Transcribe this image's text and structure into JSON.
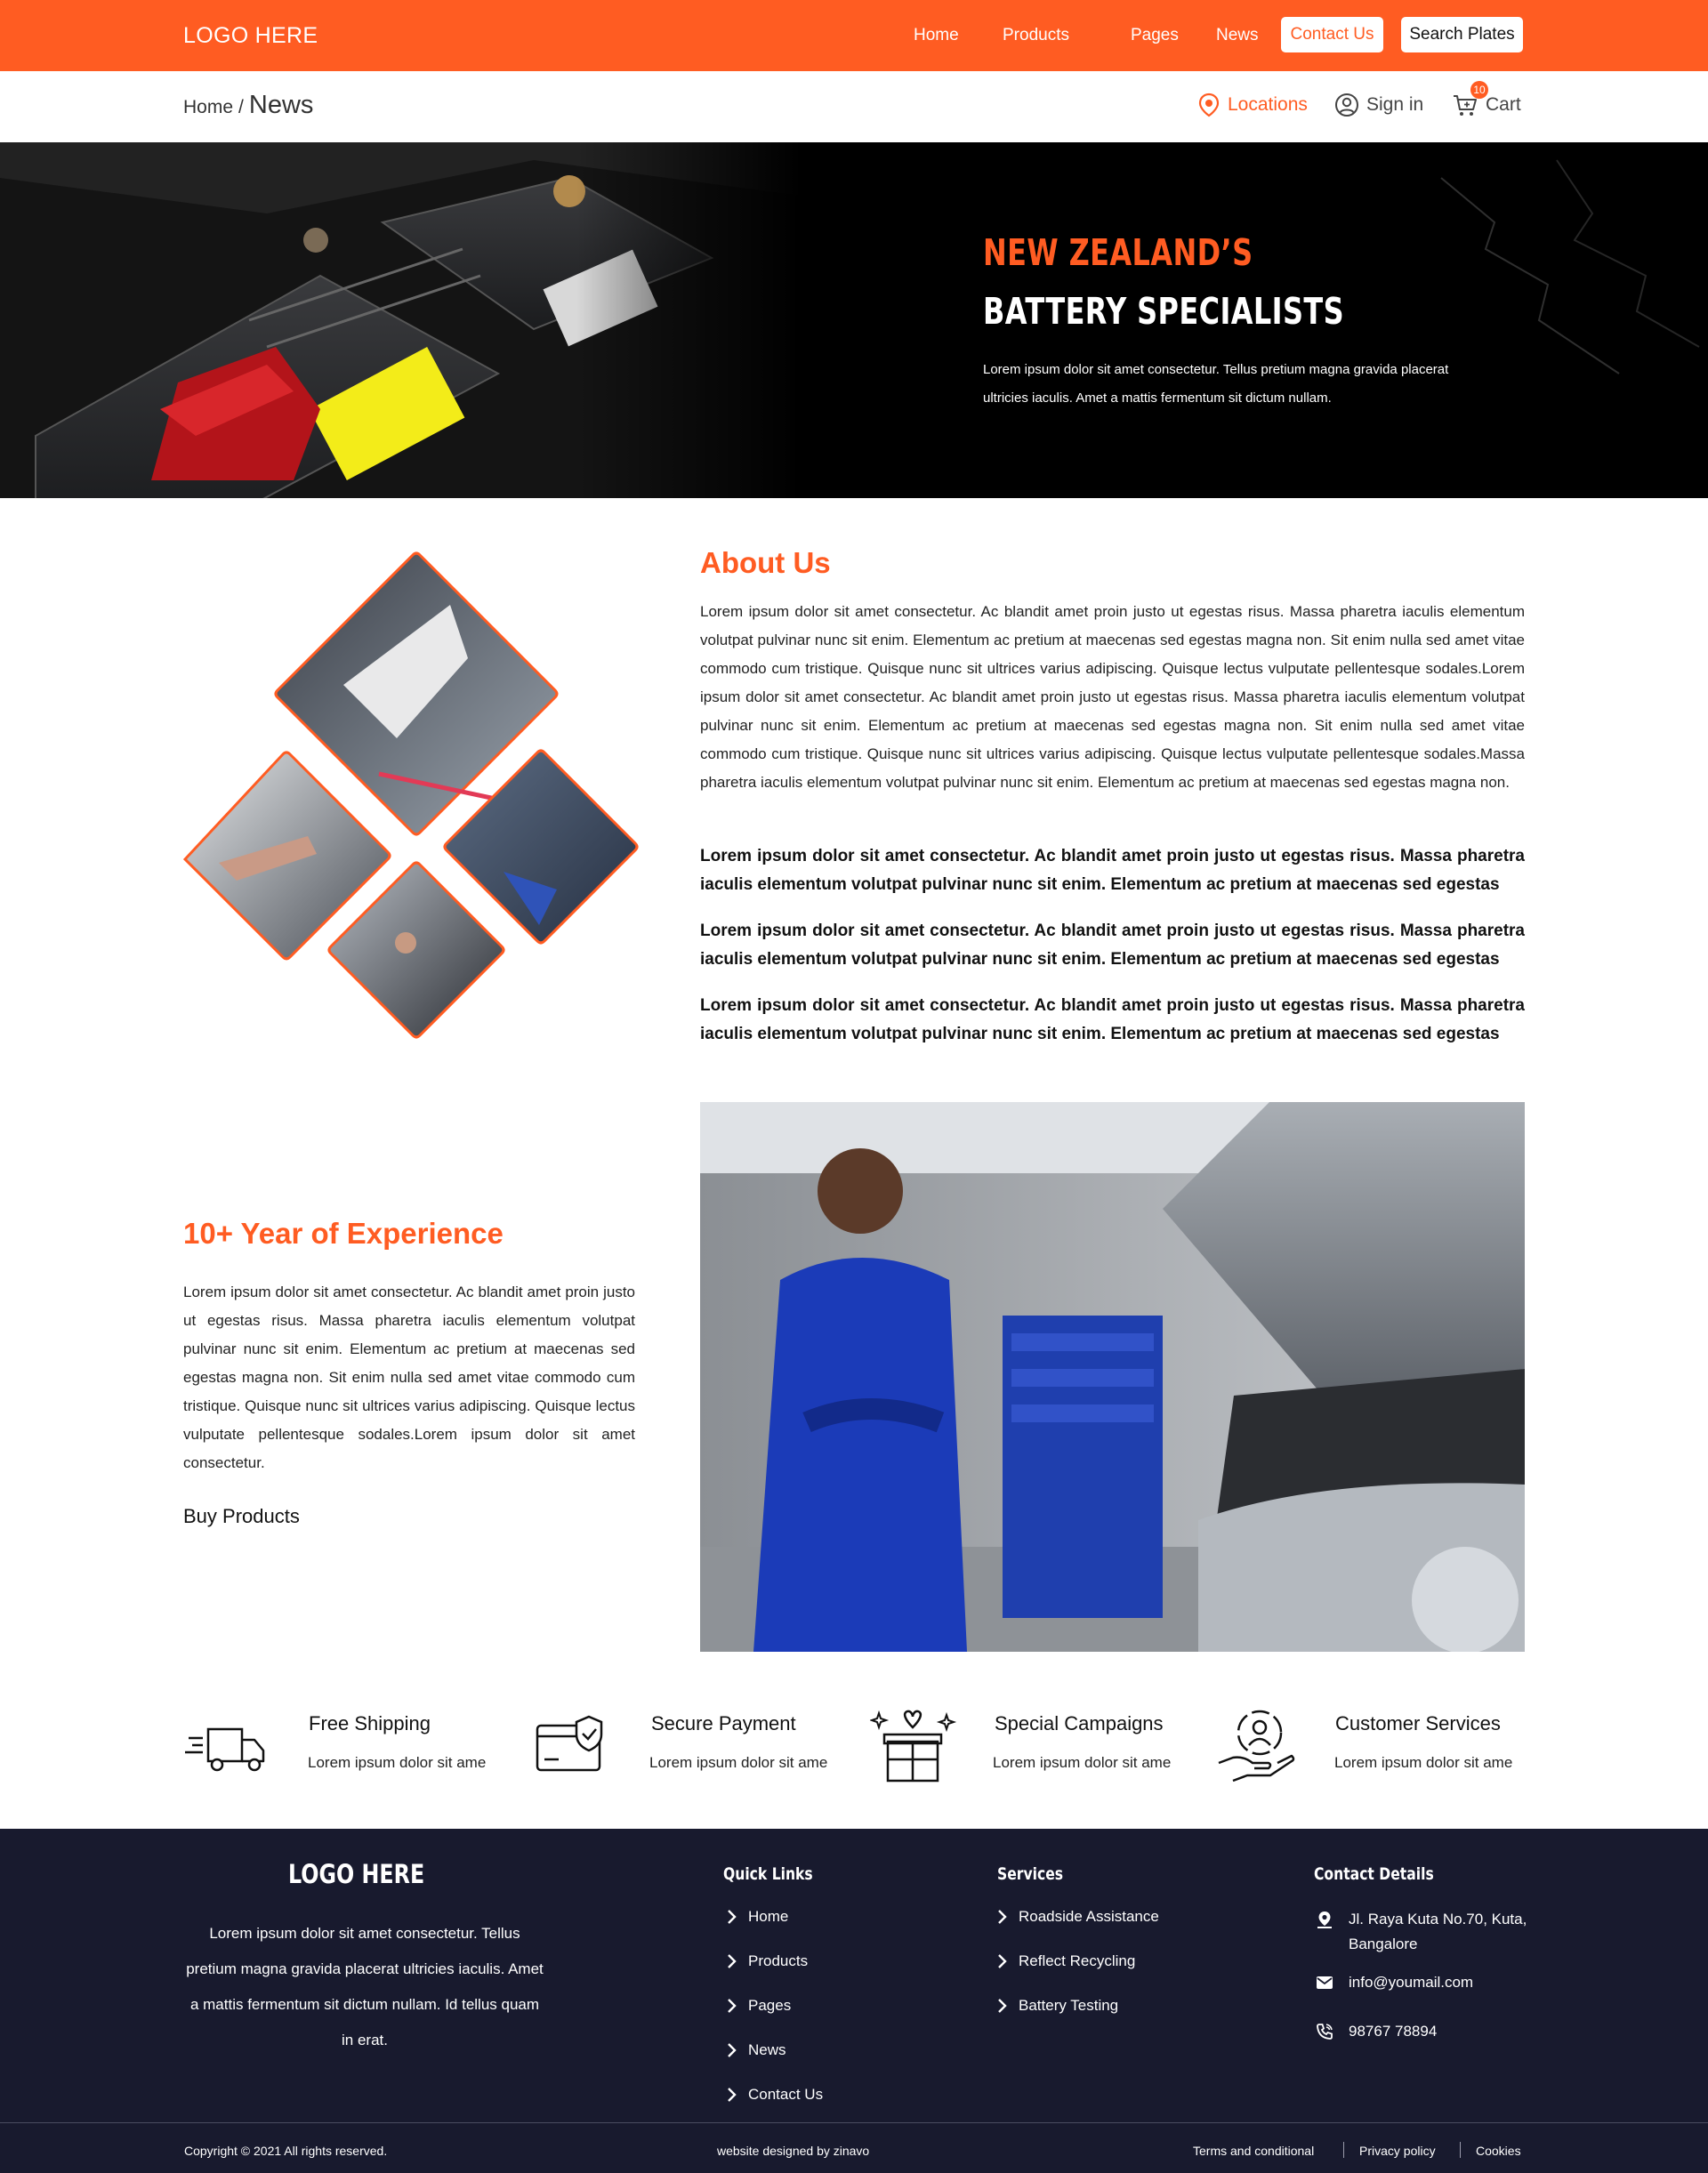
{
  "nav": {
    "logo": "LOGO HERE",
    "items": [
      "Home",
      "Products",
      "Pages",
      "News"
    ],
    "contact_button": "Contact Us",
    "search_button": "Search Plates"
  },
  "subbar": {
    "breadcrumb_home": "Home",
    "breadcrumb_sep": "/",
    "breadcrumb_current": "News",
    "locations": "Locations",
    "sign_in": "Sign in",
    "cart": "Cart",
    "cart_count": "10"
  },
  "hero": {
    "kicker": "NEW ZEALAND’S",
    "title": "BATTERY SPECIALISTS",
    "text": "Lorem ipsum dolor sit amet consectetur. Tellus pretium magna gravida placerat ultricies iaculis. Amet a mattis fermentum sit dictum nullam."
  },
  "about": {
    "title": "About Us",
    "paragraph": "Lorem ipsum dolor sit amet consectetur. Ac blandit amet proin justo ut egestas risus. Massa pharetra iaculis elementum volutpat pulvinar nunc sit enim. Elementum ac pretium at maecenas sed egestas magna non. Sit enim nulla sed amet vitae commodo cum tristique. Quisque nunc sit ultrices varius adipiscing. Quisque lectus vulputate pellentesque sodales.Lorem ipsum dolor sit amet consectetur. Ac blandit amet proin justo ut egestas risus. Massa pharetra iaculis elementum volutpat pulvinar nunc sit enim. Elementum ac pretium at maecenas sed egestas magna non. Sit enim nulla sed amet vitae commodo cum tristique. Quisque nunc sit ultrices varius adipiscing. Quisque lectus vulputate pellentesque sodales.Massa pharetra iaculis elementum volutpat pulvinar nunc sit enim. Elementum ac pretium at maecenas sed egestas magna non.",
    "bold_1": "Lorem ipsum dolor sit amet consectetur. Ac blandit amet proin justo ut egestas risus. Massa pharetra iaculis elementum volutpat pulvinar nunc sit enim. Elementum ac pretium at maecenas sed egestas",
    "bold_2": "Lorem ipsum dolor sit amet consectetur. Ac blandit amet proin justo ut egestas risus. Massa pharetra iaculis elementum volutpat pulvinar nunc sit enim. Elementum ac pretium at maecenas sed egestas",
    "bold_3": "Lorem ipsum dolor sit amet consectetur. Ac blandit amet proin justo ut egestas risus. Massa pharetra iaculis elementum volutpat pulvinar nunc sit enim. Elementum ac pretium at maecenas sed egestas"
  },
  "experience": {
    "title": "10+ Year of Experience",
    "paragraph": "Lorem ipsum dolor sit amet consectetur. Ac blandit amet proin justo ut egestas risus. Massa pharetra iaculis elementum volutpat pulvinar nunc sit enim. Elementum ac pretium at maecenas sed egestas magna non. Sit enim nulla sed amet vitae commodo cum tristique. Quisque nunc sit ultrices varius adipiscing. Quisque lectus vulputate pellentesque sodales.Lorem ipsum dolor sit amet consectetur.",
    "link": "Buy Products"
  },
  "features": [
    {
      "title": "Free Shipping",
      "text": "Lorem ipsum dolor sit ame",
      "icon": "truck-icon"
    },
    {
      "title": "Secure Payment",
      "text": "Lorem ipsum dolor sit ame",
      "icon": "secure-card-icon"
    },
    {
      "title": "Special Campaigns",
      "text": "Lorem ipsum dolor sit ame",
      "icon": "gift-icon"
    },
    {
      "title": "Customer Services",
      "text": "Lorem ipsum dolor sit ame",
      "icon": "customer-service-icon"
    }
  ],
  "footer": {
    "logo": "LOGO HERE",
    "about": "Lorem ipsum dolor sit amet consectetur. Tellus pretium magna gravida placerat ultricies iaculis. Amet a mattis fermentum sit dictum nullam. Id tellus quam in erat.",
    "quick_links_title": "Quick Links",
    "quick_links": [
      "Home",
      "Products",
      "Pages",
      "News",
      "Contact Us"
    ],
    "services_title": "Services",
    "services": [
      "Roadside Assistance",
      "Reflect Recycling",
      "Battery Testing"
    ],
    "contact_title": "Contact Details",
    "address": "Jl. Raya Kuta No.70, Kuta, Bangalore",
    "email": "info@youmail.com",
    "phone": "98767 78894",
    "copyright": "Copyright © 2021 All rights reserved.",
    "designed_by": "website designed by zinavo",
    "terms": "Terms and conditional",
    "privacy": "Privacy policy",
    "cookies": "Cookies"
  },
  "colors": {
    "accent": "#ff5c22",
    "footer_bg": "#181a2e"
  }
}
